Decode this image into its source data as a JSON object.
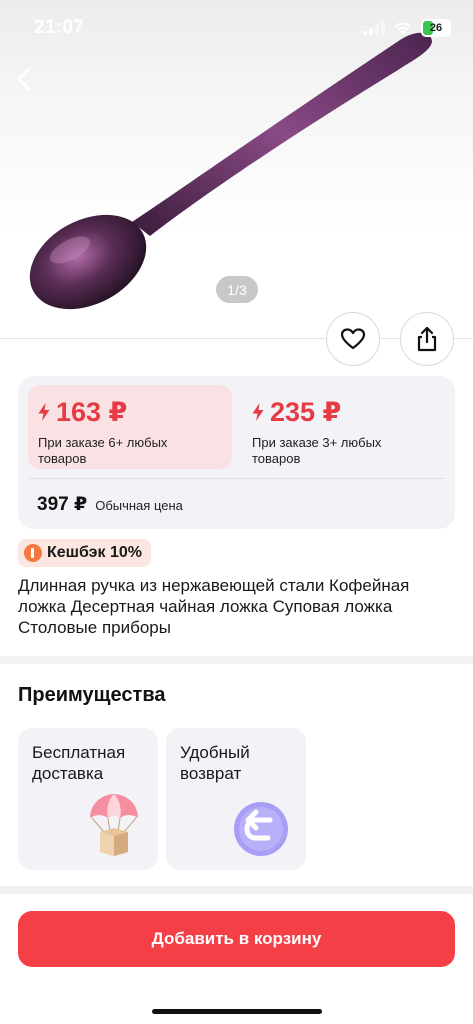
{
  "status_bar": {
    "time": "21:07",
    "battery": "26"
  },
  "gallery": {
    "pager": "1/3"
  },
  "prices": {
    "offer_1": {
      "price": "163 ₽",
      "condition": "При заказе 6+ любых товаров"
    },
    "offer_2": {
      "price": "235 ₽",
      "condition": "При заказе 3+ любых товаров"
    },
    "regular": {
      "price": "397 ₽",
      "label": "Обычная цена"
    }
  },
  "cashback": {
    "label": "Кешбэк 10%"
  },
  "product": {
    "title": "Длинная ручка из нержавеющей стали Кофейная ложка Десертная чайная ложка Суповая ложка Столовые приборы"
  },
  "benefits": {
    "title": "Преимущества",
    "items": [
      {
        "label": "Бесплатная доставка",
        "icon": "parachute-box-icon"
      },
      {
        "label": "Удобный возврат",
        "icon": "return-arrow-icon"
      }
    ]
  },
  "cta": {
    "label": "Добавить в корзину"
  },
  "colors": {
    "accent": "#f53f47",
    "price": "#e63b44",
    "card_bg": "#f2f2f7",
    "offer_highlight": "#f9e1e4"
  }
}
